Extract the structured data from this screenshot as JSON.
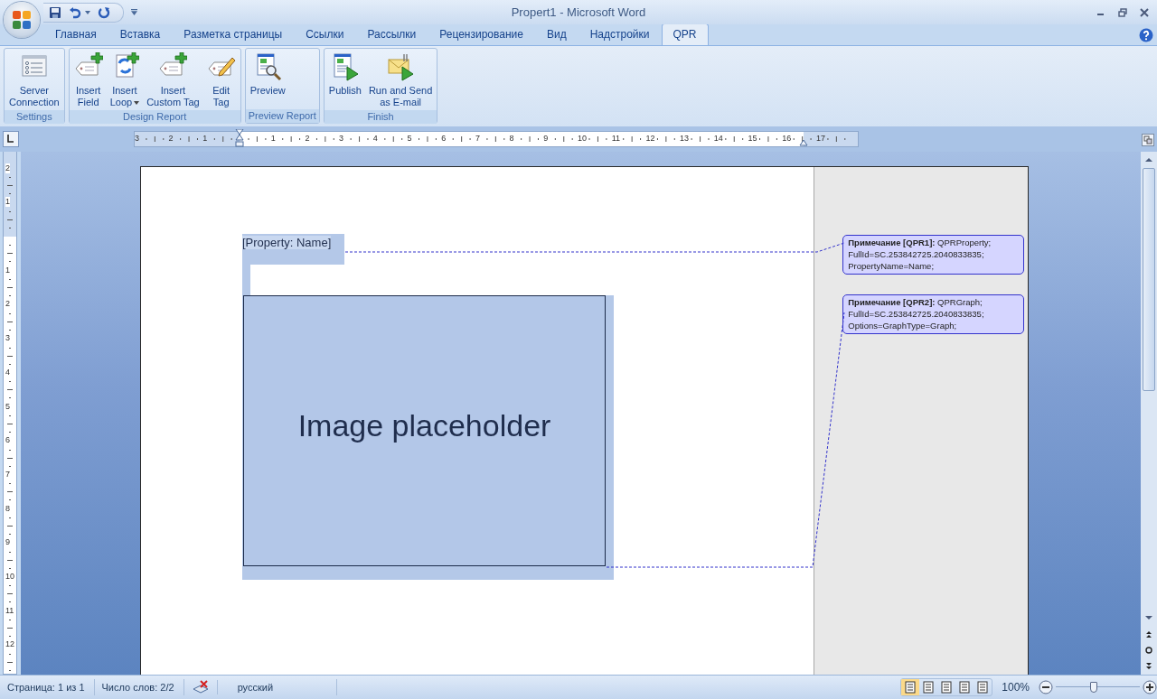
{
  "window": {
    "title": "Propert1 - Microsoft Word"
  },
  "tabs": [
    {
      "label": "Главная",
      "selected": false
    },
    {
      "label": "Вставка",
      "selected": false
    },
    {
      "label": "Разметка страницы",
      "selected": false
    },
    {
      "label": "Ссылки",
      "selected": false
    },
    {
      "label": "Рассылки",
      "selected": false
    },
    {
      "label": "Рецензирование",
      "selected": false
    },
    {
      "label": "Вид",
      "selected": false
    },
    {
      "label": "Надстройки",
      "selected": false
    },
    {
      "label": "QPR",
      "selected": true
    }
  ],
  "ribbon": {
    "groups": [
      {
        "label": "Settings",
        "buttons": [
          {
            "lines": [
              "Server",
              "Connection"
            ],
            "dropdown": false
          }
        ]
      },
      {
        "label": "Design Report",
        "buttons": [
          {
            "lines": [
              "Insert",
              "Field"
            ],
            "dropdown": false
          },
          {
            "lines": [
              "Insert",
              "Loop"
            ],
            "dropdown": true
          },
          {
            "lines": [
              "Insert",
              "Custom Tag"
            ],
            "dropdown": false
          },
          {
            "lines": [
              "Edit",
              "Tag"
            ],
            "dropdown": false
          }
        ]
      },
      {
        "label": "Preview Report",
        "buttons": [
          {
            "lines": [
              "Preview"
            ],
            "dropdown": false
          }
        ]
      },
      {
        "label": "Finish",
        "buttons": [
          {
            "lines": [
              "Publish"
            ],
            "dropdown": false
          },
          {
            "lines": [
              "Run and Send",
              "as E-mail"
            ],
            "dropdown": false
          }
        ]
      }
    ]
  },
  "ruler": {
    "left_labels": [
      "3",
      "2",
      "1"
    ],
    "right_labels": [
      "1",
      "2",
      "3",
      "4",
      "5",
      "6",
      "7",
      "8",
      "9",
      "10",
      "11",
      "12",
      "13",
      "14",
      "15",
      "16",
      "17"
    ]
  },
  "vertical_ruler": {
    "top_labels": [
      "2",
      "1"
    ],
    "labels": [
      "1",
      "2",
      "3",
      "4",
      "5",
      "6",
      "7",
      "8",
      "9",
      "10",
      "11",
      "12"
    ]
  },
  "document": {
    "field_tag": "[Property: Name]",
    "image_placeholder": "Image placeholder",
    "comments": [
      {
        "text": "**Примечание [QPR1]:** QPRProperty; FullId=SC.253842725.2040833835; PropertyName=Name;"
      },
      {
        "text": "**Примечание [QPR2]:** QPRGraph; FullId=SC.253842725.2040833835; Options=GraphType=Graph;"
      }
    ]
  },
  "status_bar": {
    "page": "Страница: 1 из 1",
    "words": "Число слов: 2/2",
    "language": "русский",
    "views": [
      {
        "selected": true
      },
      {
        "selected": false
      },
      {
        "selected": false
      },
      {
        "selected": false
      },
      {
        "selected": false
      }
    ],
    "zoom": "100%",
    "zoom_slider": {
      "level": 0.45
    }
  }
}
